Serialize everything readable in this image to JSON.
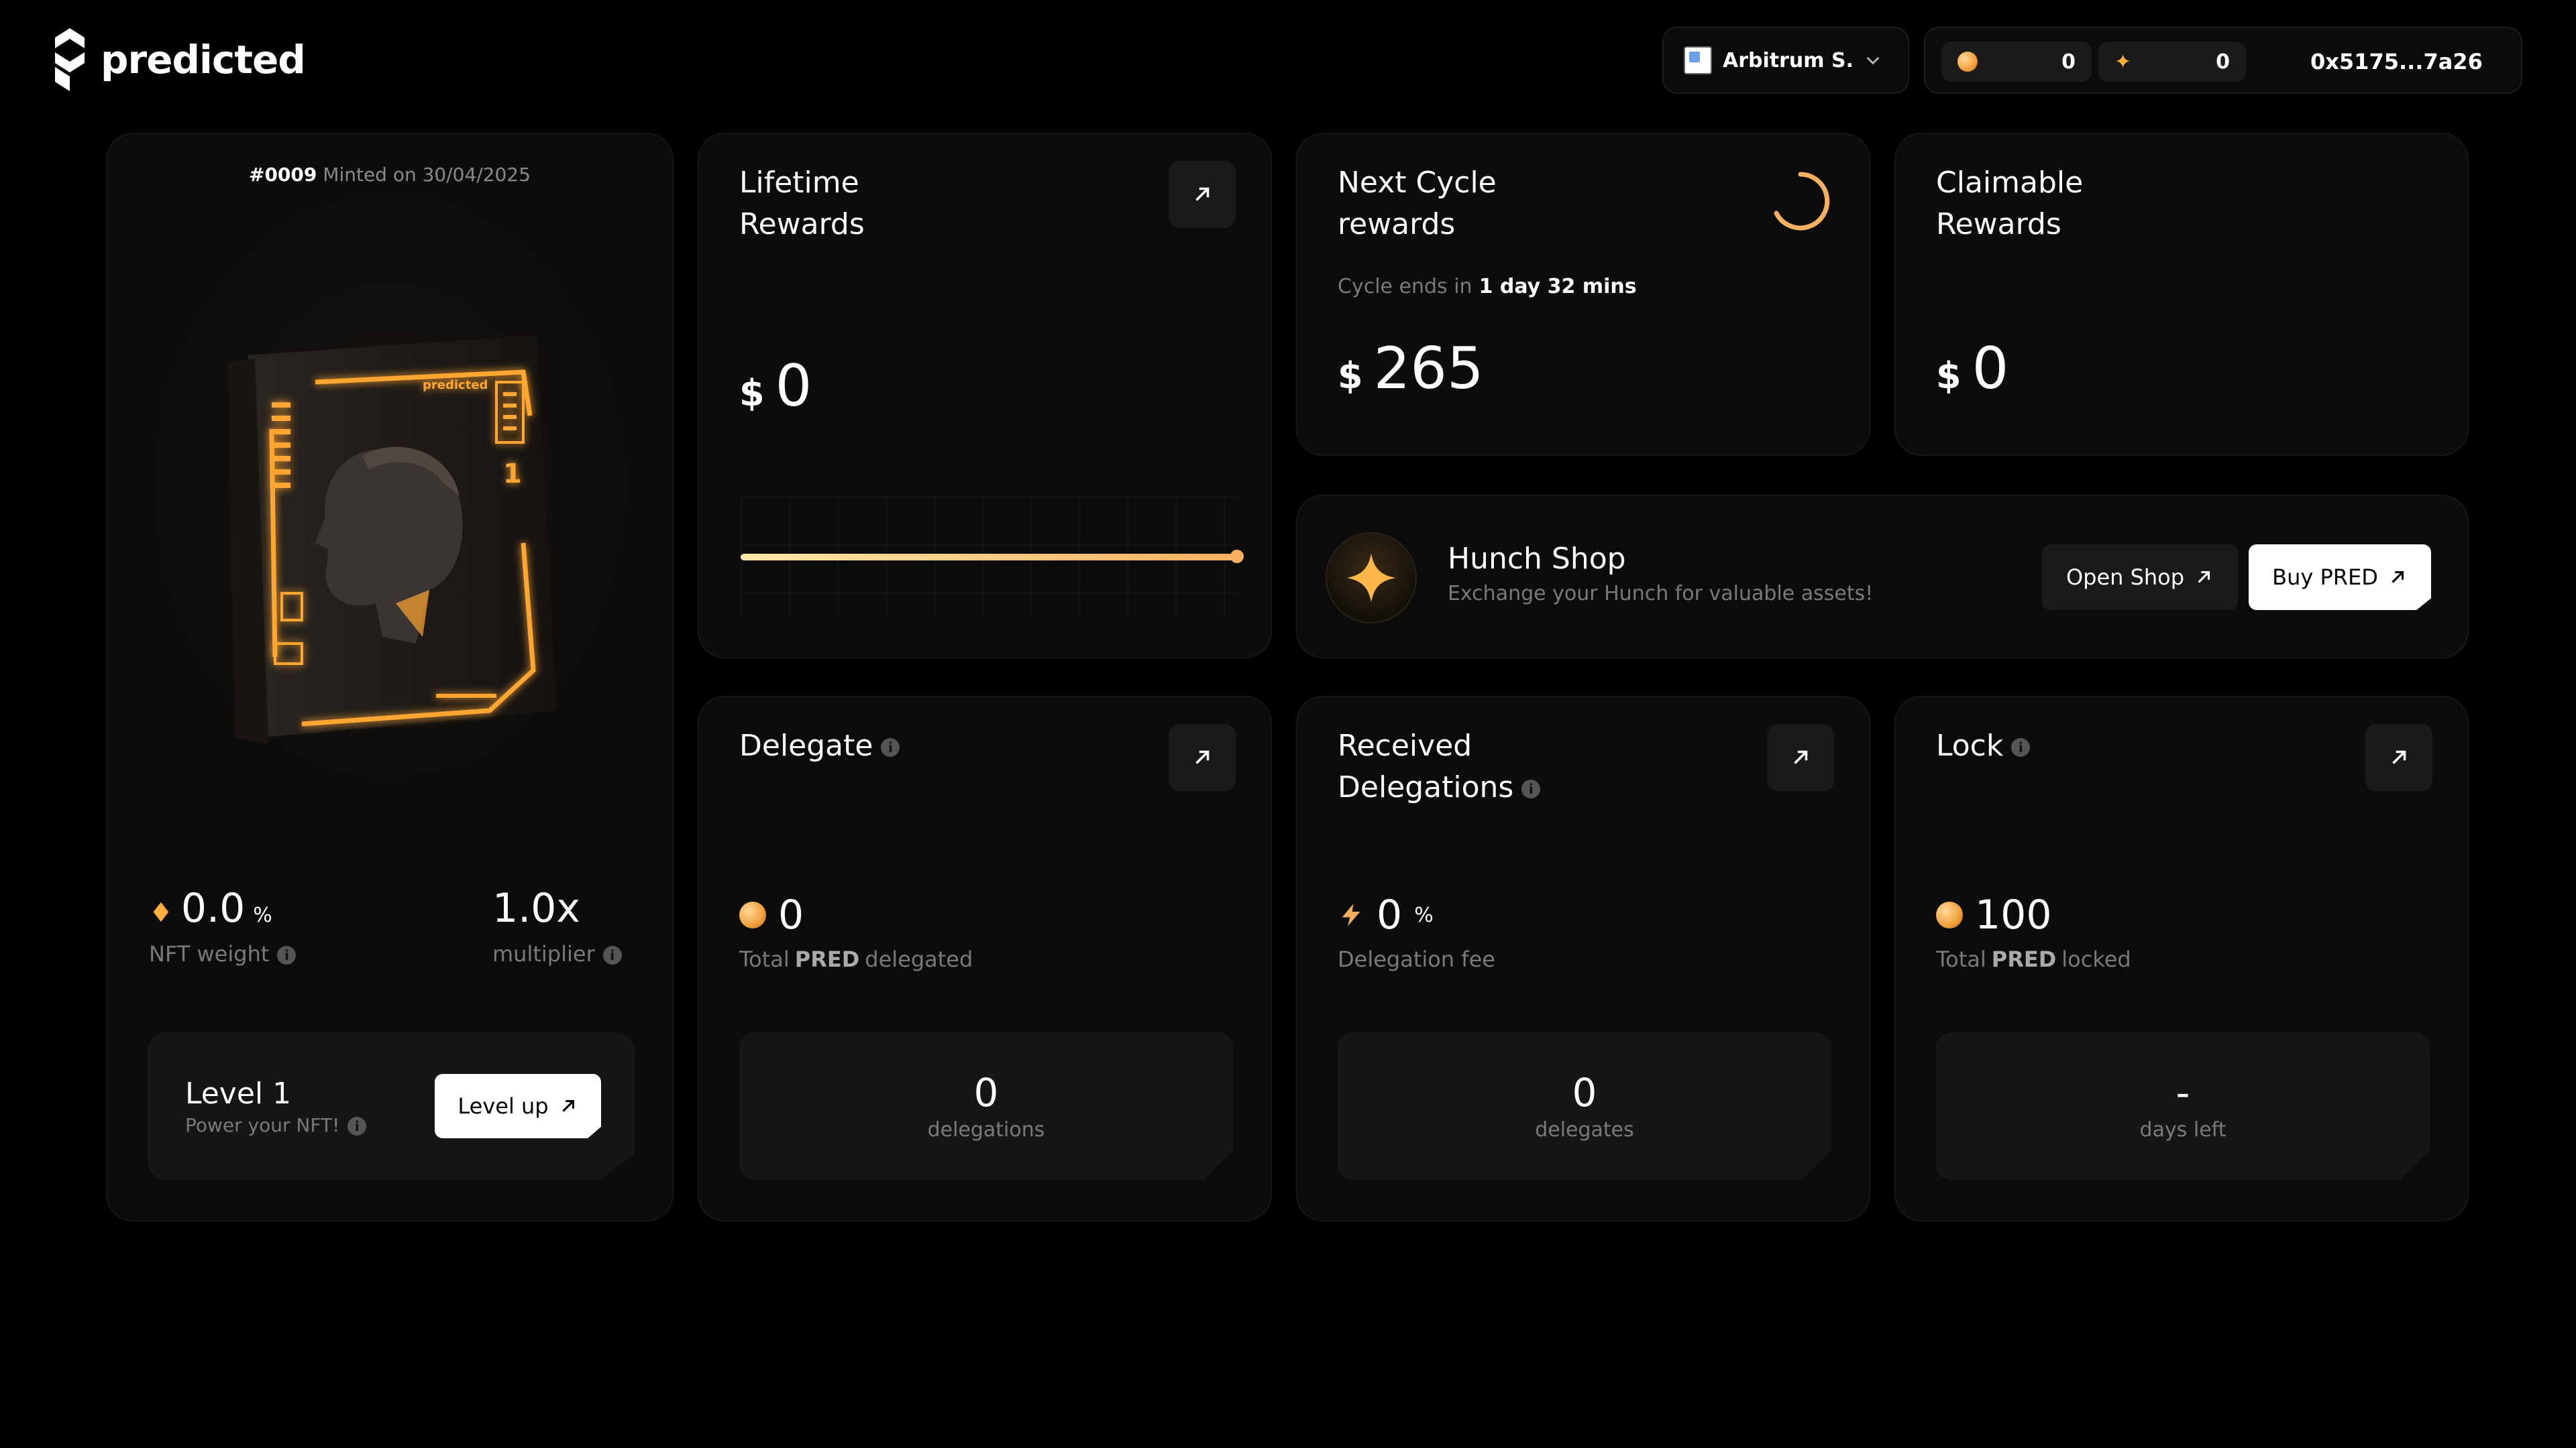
{
  "header": {
    "brand": "predicted",
    "network": "Arbitrum S.",
    "balance_pred": "0",
    "balance_hunch": "0",
    "address": "0x5175...7a26"
  },
  "nft": {
    "id": "#0009",
    "minted_text": "Minted on 30/04/2025",
    "weight_value": "0.0",
    "weight_unit": "%",
    "weight_label": "NFT weight",
    "multiplier_value": "1.0x",
    "multiplier_label": "multiplier",
    "level_title": "Level 1",
    "level_sub": "Power your NFT!",
    "level_up_label": "Level up"
  },
  "lifetime": {
    "title_line1": "Lifetime",
    "title_line2": "Rewards",
    "currency": "$",
    "value": "0",
    "progress": 1.0
  },
  "cycle": {
    "title_line1": "Next Cycle",
    "title_line2": "rewards",
    "ends_label": "Cycle ends in",
    "ends_value": "1 day 32 mins",
    "currency": "$",
    "value": "265"
  },
  "claimable": {
    "title_line1": "Claimable",
    "title_line2": "Rewards",
    "currency": "$",
    "value": "0"
  },
  "shop": {
    "title": "Hunch Shop",
    "subtitle": "Exchange your Hunch for valuable assets!",
    "open_label": "Open Shop",
    "buy_label": "Buy PRED"
  },
  "delegate": {
    "title": "Delegate",
    "value": "0",
    "label_pre": "Total",
    "label_token": "PRED",
    "label_post": "delegated",
    "box_value": "0",
    "box_label": "delegations"
  },
  "received": {
    "title_line1": "Received",
    "title_line2": "Delegations",
    "value": "0",
    "unit": "%",
    "label": "Delegation fee",
    "box_value": "0",
    "box_label": "delegates"
  },
  "lock": {
    "title": "Lock",
    "value": "100",
    "label_pre": "Total",
    "label_token": "PRED",
    "label_post": "locked",
    "box_value": "-",
    "box_label": "days left"
  },
  "colors": {
    "accent": "#f6b060",
    "accent_light": "#ffe7a8",
    "background": "#000000",
    "card": "#0c0c0c"
  }
}
